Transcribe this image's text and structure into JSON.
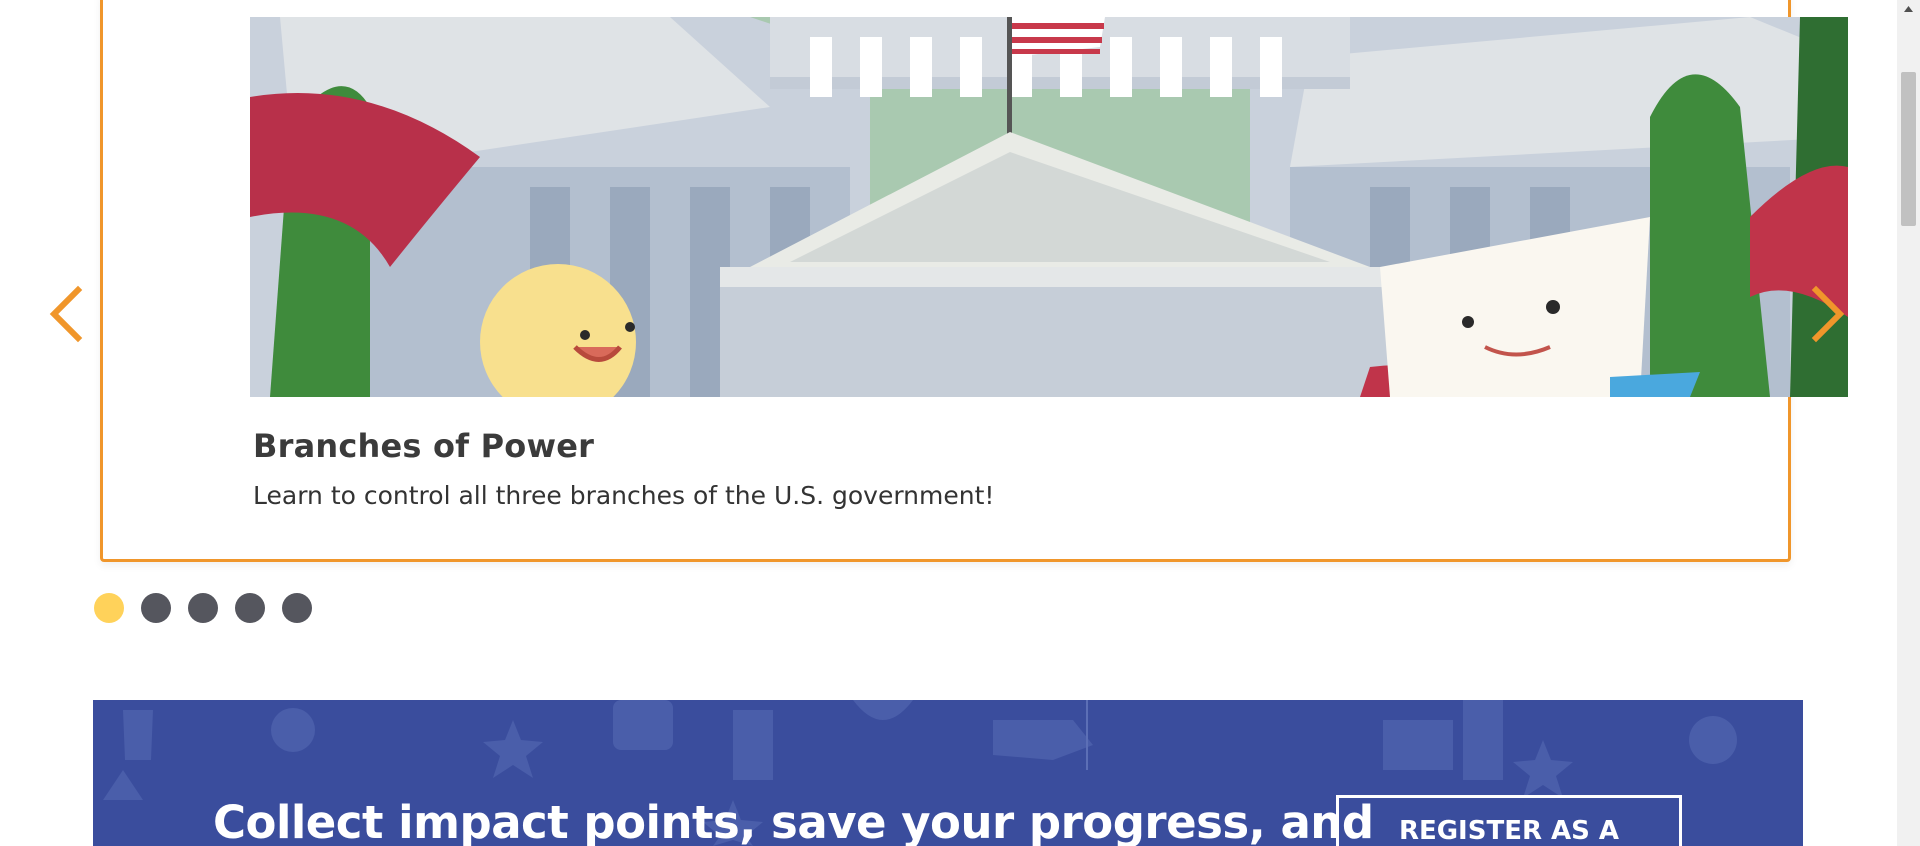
{
  "carousel": {
    "slide": {
      "image_alt": "Capitol building illustration",
      "title": "Branches of Power",
      "description": "Learn to control all three branches of the U.S. government!"
    },
    "prev_icon": "chevron-left-icon",
    "next_icon": "chevron-right-icon",
    "dots": [
      {
        "active": true
      },
      {
        "active": false
      },
      {
        "active": false
      },
      {
        "active": false
      },
      {
        "active": false
      }
    ],
    "colors": {
      "border": "#f0962b",
      "arrow": "#f0962b",
      "dot_active": "#ffd25a",
      "dot_inactive": "#55565e"
    }
  },
  "banner": {
    "text": "Collect impact points, save your progress, and",
    "button_label": "REGISTER AS A",
    "colors": {
      "background": "#3a4d9d",
      "text": "#ffffff"
    }
  },
  "scrollbar": {
    "up_icon": "triangle-up-icon"
  }
}
